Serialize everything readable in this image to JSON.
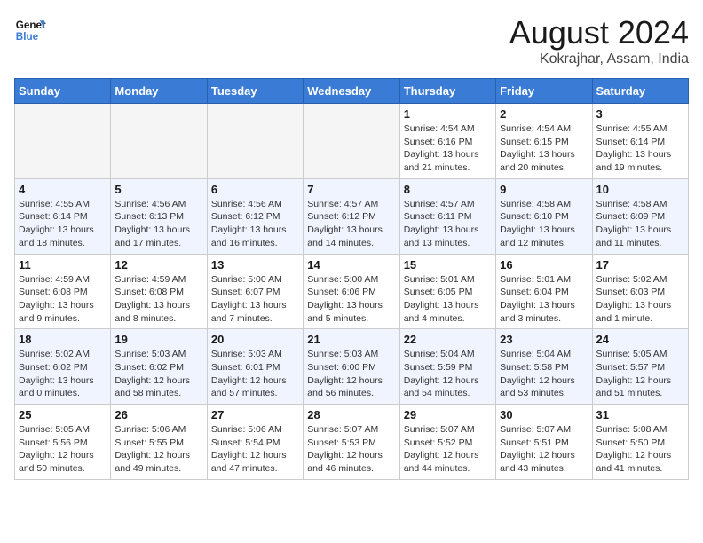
{
  "header": {
    "logo_line1": "General",
    "logo_line2": "Blue",
    "month_year": "August 2024",
    "location": "Kokrajhar, Assam, India"
  },
  "weekdays": [
    "Sunday",
    "Monday",
    "Tuesday",
    "Wednesday",
    "Thursday",
    "Friday",
    "Saturday"
  ],
  "weeks": [
    [
      {
        "day": "",
        "info": ""
      },
      {
        "day": "",
        "info": ""
      },
      {
        "day": "",
        "info": ""
      },
      {
        "day": "",
        "info": ""
      },
      {
        "day": "1",
        "info": "Sunrise: 4:54 AM\nSunset: 6:16 PM\nDaylight: 13 hours\nand 21 minutes."
      },
      {
        "day": "2",
        "info": "Sunrise: 4:54 AM\nSunset: 6:15 PM\nDaylight: 13 hours\nand 20 minutes."
      },
      {
        "day": "3",
        "info": "Sunrise: 4:55 AM\nSunset: 6:14 PM\nDaylight: 13 hours\nand 19 minutes."
      }
    ],
    [
      {
        "day": "4",
        "info": "Sunrise: 4:55 AM\nSunset: 6:14 PM\nDaylight: 13 hours\nand 18 minutes."
      },
      {
        "day": "5",
        "info": "Sunrise: 4:56 AM\nSunset: 6:13 PM\nDaylight: 13 hours\nand 17 minutes."
      },
      {
        "day": "6",
        "info": "Sunrise: 4:56 AM\nSunset: 6:12 PM\nDaylight: 13 hours\nand 16 minutes."
      },
      {
        "day": "7",
        "info": "Sunrise: 4:57 AM\nSunset: 6:12 PM\nDaylight: 13 hours\nand 14 minutes."
      },
      {
        "day": "8",
        "info": "Sunrise: 4:57 AM\nSunset: 6:11 PM\nDaylight: 13 hours\nand 13 minutes."
      },
      {
        "day": "9",
        "info": "Sunrise: 4:58 AM\nSunset: 6:10 PM\nDaylight: 13 hours\nand 12 minutes."
      },
      {
        "day": "10",
        "info": "Sunrise: 4:58 AM\nSunset: 6:09 PM\nDaylight: 13 hours\nand 11 minutes."
      }
    ],
    [
      {
        "day": "11",
        "info": "Sunrise: 4:59 AM\nSunset: 6:08 PM\nDaylight: 13 hours\nand 9 minutes."
      },
      {
        "day": "12",
        "info": "Sunrise: 4:59 AM\nSunset: 6:08 PM\nDaylight: 13 hours\nand 8 minutes."
      },
      {
        "day": "13",
        "info": "Sunrise: 5:00 AM\nSunset: 6:07 PM\nDaylight: 13 hours\nand 7 minutes."
      },
      {
        "day": "14",
        "info": "Sunrise: 5:00 AM\nSunset: 6:06 PM\nDaylight: 13 hours\nand 5 minutes."
      },
      {
        "day": "15",
        "info": "Sunrise: 5:01 AM\nSunset: 6:05 PM\nDaylight: 13 hours\nand 4 minutes."
      },
      {
        "day": "16",
        "info": "Sunrise: 5:01 AM\nSunset: 6:04 PM\nDaylight: 13 hours\nand 3 minutes."
      },
      {
        "day": "17",
        "info": "Sunrise: 5:02 AM\nSunset: 6:03 PM\nDaylight: 13 hours\nand 1 minute."
      }
    ],
    [
      {
        "day": "18",
        "info": "Sunrise: 5:02 AM\nSunset: 6:02 PM\nDaylight: 13 hours\nand 0 minutes."
      },
      {
        "day": "19",
        "info": "Sunrise: 5:03 AM\nSunset: 6:02 PM\nDaylight: 12 hours\nand 58 minutes."
      },
      {
        "day": "20",
        "info": "Sunrise: 5:03 AM\nSunset: 6:01 PM\nDaylight: 12 hours\nand 57 minutes."
      },
      {
        "day": "21",
        "info": "Sunrise: 5:03 AM\nSunset: 6:00 PM\nDaylight: 12 hours\nand 56 minutes."
      },
      {
        "day": "22",
        "info": "Sunrise: 5:04 AM\nSunset: 5:59 PM\nDaylight: 12 hours\nand 54 minutes."
      },
      {
        "day": "23",
        "info": "Sunrise: 5:04 AM\nSunset: 5:58 PM\nDaylight: 12 hours\nand 53 minutes."
      },
      {
        "day": "24",
        "info": "Sunrise: 5:05 AM\nSunset: 5:57 PM\nDaylight: 12 hours\nand 51 minutes."
      }
    ],
    [
      {
        "day": "25",
        "info": "Sunrise: 5:05 AM\nSunset: 5:56 PM\nDaylight: 12 hours\nand 50 minutes."
      },
      {
        "day": "26",
        "info": "Sunrise: 5:06 AM\nSunset: 5:55 PM\nDaylight: 12 hours\nand 49 minutes."
      },
      {
        "day": "27",
        "info": "Sunrise: 5:06 AM\nSunset: 5:54 PM\nDaylight: 12 hours\nand 47 minutes."
      },
      {
        "day": "28",
        "info": "Sunrise: 5:07 AM\nSunset: 5:53 PM\nDaylight: 12 hours\nand 46 minutes."
      },
      {
        "day": "29",
        "info": "Sunrise: 5:07 AM\nSunset: 5:52 PM\nDaylight: 12 hours\nand 44 minutes."
      },
      {
        "day": "30",
        "info": "Sunrise: 5:07 AM\nSunset: 5:51 PM\nDaylight: 12 hours\nand 43 minutes."
      },
      {
        "day": "31",
        "info": "Sunrise: 5:08 AM\nSunset: 5:50 PM\nDaylight: 12 hours\nand 41 minutes."
      }
    ]
  ]
}
